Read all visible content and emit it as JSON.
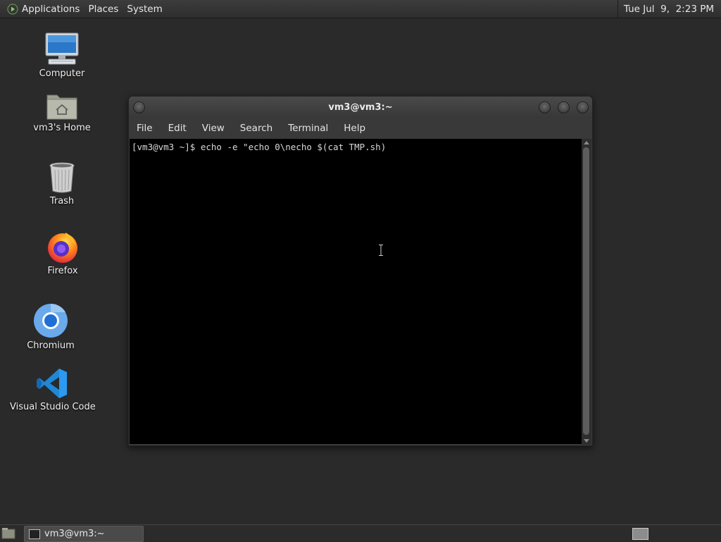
{
  "top_panel": {
    "menus": [
      "Applications",
      "Places",
      "System"
    ],
    "clock": "Tue Jul  9,  2:23 PM"
  },
  "desktop_icons": [
    {
      "label": "Computer",
      "icon": "computer-icon"
    },
    {
      "label": "vm3's Home",
      "icon": "home-folder-icon"
    },
    {
      "label": "Trash",
      "icon": "trash-icon"
    },
    {
      "label": "Firefox",
      "icon": "firefox-icon"
    },
    {
      "label": "Chromium",
      "icon": "chromium-icon"
    },
    {
      "label": "Visual Studio Code",
      "icon": "vscode-icon"
    }
  ],
  "terminal": {
    "title": "vm3@vm3:~",
    "menu": [
      "File",
      "Edit",
      "View",
      "Search",
      "Terminal",
      "Help"
    ],
    "lines": [
      "[vm3@vm3 ~]$ echo -e \"echo 0\\necho $(cat TMP.sh)"
    ]
  },
  "taskbar": {
    "task_label": "vm3@vm3:~"
  },
  "colors": {
    "desktop_bg": "#2a2a2a",
    "terminal_bg": "#000000",
    "panel_bg": "#333333"
  }
}
